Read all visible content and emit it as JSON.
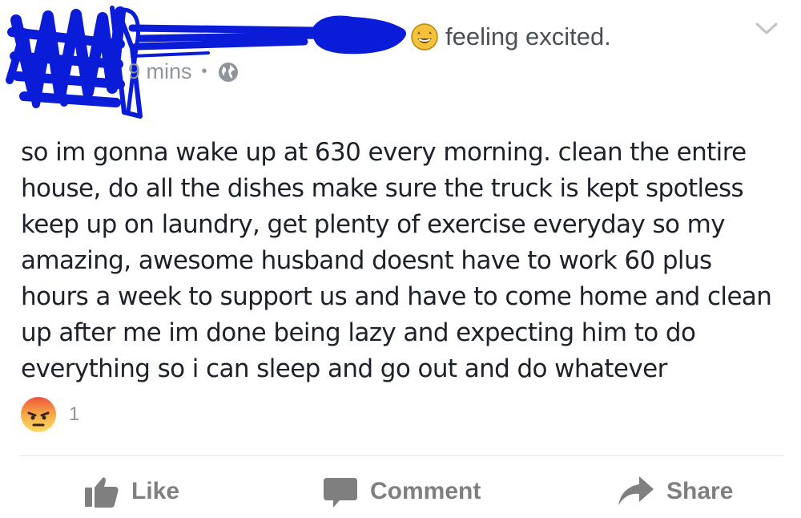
{
  "header": {
    "feeling_text": "feeling excited.",
    "time_text": "9 mins",
    "separator": "•",
    "privacy_icon": "globe-icon",
    "redaction_color": "#0a1cd8"
  },
  "post": {
    "text": "so im gonna wake up at 630 every morning.  clean the entire\nhouse, do all the dishes  make sure the truck is kept spotless\nkeep up on laundry, get plenty of exercise everyday so my\namazing, awesome husband doesnt have to work 60 plus\nhours a week to support us and have to come home and clean\nup after me   im done being lazy and expecting him to do\neverything so i can sleep and go out and do whatever"
  },
  "reactions": {
    "icon": "angry-face-icon",
    "count": "1"
  },
  "actions": {
    "like_label": "Like",
    "comment_label": "Comment",
    "share_label": "Share",
    "icon_color": "#7f7f7f"
  }
}
